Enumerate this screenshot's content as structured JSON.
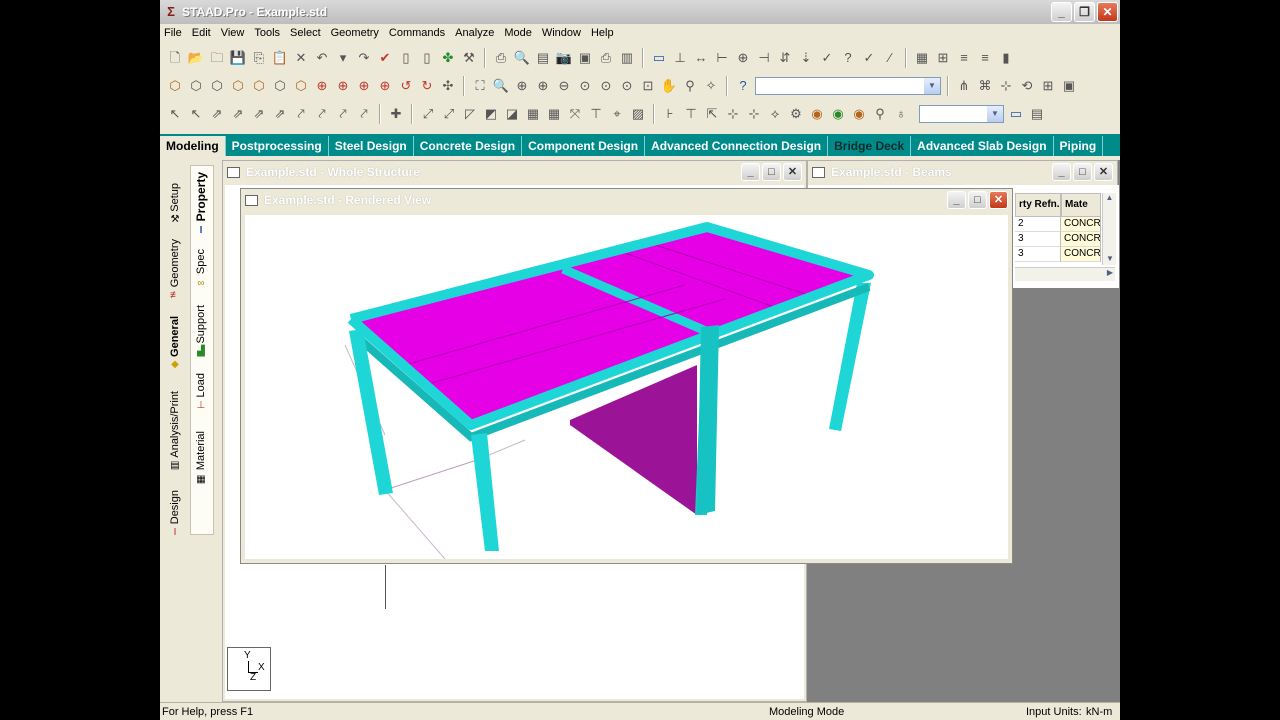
{
  "window": {
    "title": "STAAD.Pro - Example.std"
  },
  "menu": [
    "File",
    "Edit",
    "View",
    "Tools",
    "Select",
    "Geometry",
    "Commands",
    "Analyze",
    "Mode",
    "Window",
    "Help"
  ],
  "tabs": [
    {
      "label": "Modeling",
      "active": true
    },
    {
      "label": "Postprocessing"
    },
    {
      "label": "Steel Design"
    },
    {
      "label": "Concrete Design"
    },
    {
      "label": "Component Design"
    },
    {
      "label": "Advanced Connection Design"
    },
    {
      "label": "Bridge Deck",
      "dark": true
    },
    {
      "label": "Advanced Slab Design"
    },
    {
      "label": "Piping"
    }
  ],
  "left_tabs_outer": [
    {
      "label": "Setup",
      "icon": "setup-icon"
    },
    {
      "label": "Geometry",
      "icon": "geometry-icon"
    },
    {
      "label": "General",
      "icon": "general-icon",
      "bold": true
    },
    {
      "label": "Analysis/Print",
      "icon": "analysis-icon"
    },
    {
      "label": "Design",
      "icon": "design-icon"
    }
  ],
  "left_tabs_inner": [
    {
      "label": "Property",
      "icon": "property-icon",
      "bold": true
    },
    {
      "label": "Spec",
      "icon": "spec-icon"
    },
    {
      "label": "Support",
      "icon": "support-icon"
    },
    {
      "label": "Load",
      "icon": "load-icon"
    },
    {
      "label": "Material",
      "icon": "material-icon"
    }
  ],
  "windows": {
    "whole_structure": {
      "title": "Example.std - Whole Structure"
    },
    "beams": {
      "title": "Example.std - Beams",
      "columns": [
        "rty Refn.",
        "Mate"
      ],
      "rows": [
        [
          "2",
          "CONCR"
        ],
        [
          "3",
          "CONCR"
        ],
        [
          "3",
          "CONCR"
        ]
      ]
    },
    "rendered": {
      "title": "Example.std - Rendered View"
    }
  },
  "axis_labels": {
    "y": "Y",
    "x": "X",
    "z": "Z"
  },
  "status": {
    "help": "For Help, press F1",
    "mode": "Modeling Mode",
    "units_label": "Input Units:",
    "units": "kN-m"
  },
  "colors": {
    "slab": "#e600e6",
    "wall": "#9b1497",
    "beam": "#1fd6d6",
    "tabbar": "#008b8b"
  }
}
